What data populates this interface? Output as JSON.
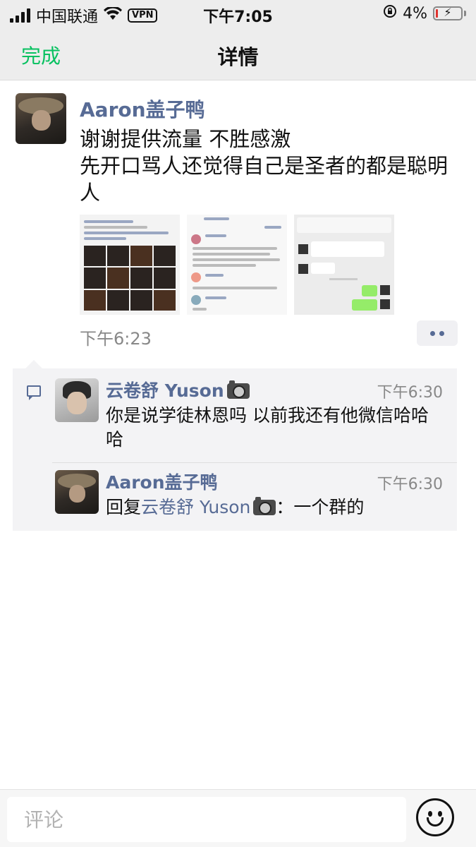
{
  "status_bar": {
    "carrier": "中国联通",
    "vpn": "VPN",
    "time": "下午7:05",
    "battery": "4%"
  },
  "nav": {
    "done": "完成",
    "title": "详情"
  },
  "post": {
    "author": "Aaron盖子鸭",
    "text_line1": "谢谢提供流量 不胜感激",
    "text_line2": "先开口骂人还觉得自己是圣者的都是聪明人",
    "time": "下午6:23"
  },
  "comments": [
    {
      "author": "云卷舒 Yuson",
      "time": "下午6:30",
      "text": "你是说学徒林恩吗 以前我还有他微信哈哈哈"
    },
    {
      "author": "Aaron盖子鸭",
      "time": "下午6:30",
      "reply_prefix": "回复",
      "reply_to": "云卷舒 Yuson",
      "text": "：一个群的"
    }
  ],
  "comment_box": {
    "placeholder": "评论"
  }
}
